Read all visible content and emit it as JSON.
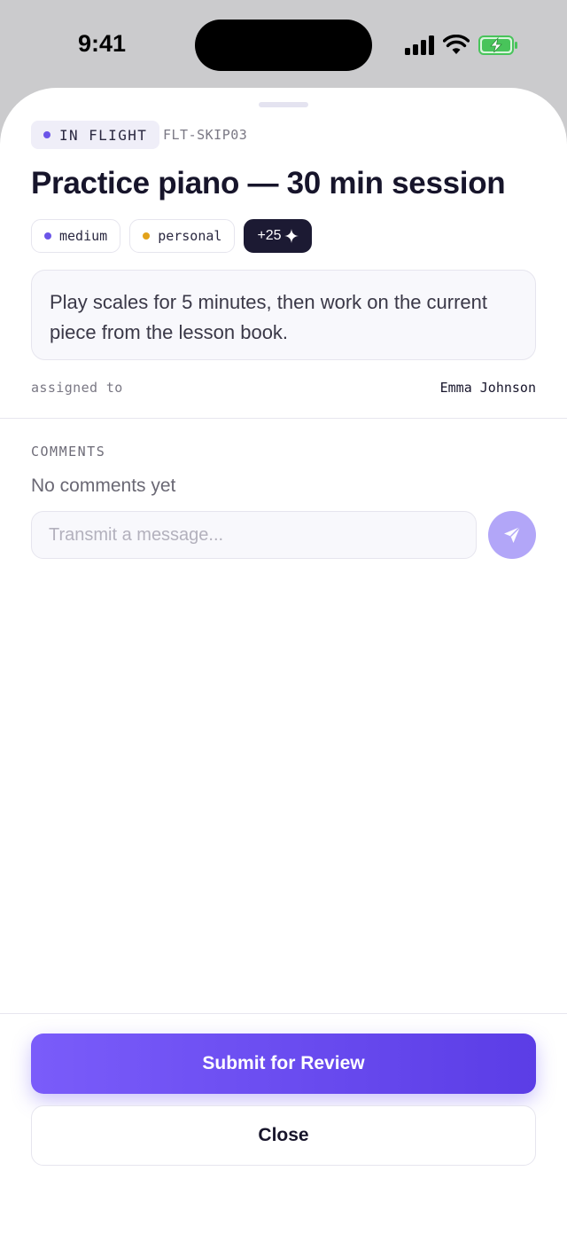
{
  "status_bar": {
    "time": "9:41"
  },
  "task": {
    "status": "IN FLIGHT",
    "status_color": "#6b55e8",
    "flight_id": "FLT-SKIP03",
    "title": "Practice piano — 30 min session",
    "tags": [
      {
        "label": "medium",
        "dot_color": "#6b55e8"
      },
      {
        "label": "personal",
        "dot_color": "#e2a21a"
      }
    ],
    "points": "+25",
    "points_icon": "sparkle-icon",
    "description": "Play scales for 5 minutes, then work on the current piece from the lesson book.",
    "assigned_label": "assigned to",
    "assignee": "Emma Johnson"
  },
  "comments": {
    "label": "COMMENTS",
    "empty_text": "No comments yet",
    "input_placeholder": "Transmit a message...",
    "input_value": "",
    "send_icon": "send-icon"
  },
  "actions": {
    "submit_label": "Submit for Review",
    "close_label": "Close"
  },
  "colors": {
    "accent": "#6b55e8",
    "title": "#17152b"
  }
}
